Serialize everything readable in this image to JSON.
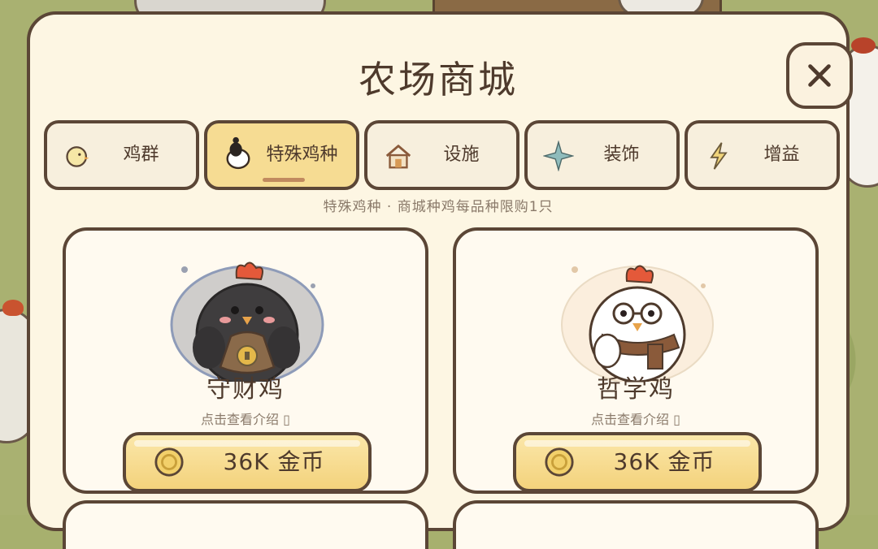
{
  "shop": {
    "title": "农场商城",
    "subtitle": "特殊鸡种 · 商城种鸡每品种限购1只"
  },
  "tabs": [
    {
      "label": "鸡群",
      "icon": "chick-icon",
      "active": false
    },
    {
      "label": "特殊鸡种",
      "icon": "special-chicken-icon",
      "active": true
    },
    {
      "label": "设施",
      "icon": "house-icon",
      "active": false
    },
    {
      "label": "装饰",
      "icon": "sparkle-icon",
      "active": false
    },
    {
      "label": "增益",
      "icon": "lightning-icon",
      "active": false
    }
  ],
  "products": [
    {
      "name": "守财鸡",
      "hint": "点击查看介绍 ▯",
      "price": "36K 金币",
      "icon": "money-bag-chicken-icon"
    },
    {
      "name": "哲学鸡",
      "hint": "点击查看介绍 ▯",
      "price": "36K 金币",
      "icon": "glasses-chicken-icon"
    }
  ],
  "colors": {
    "border": "#5b4636",
    "panel": "#fdf6e3",
    "active_tab": "#f6dc93",
    "button": "#f3d27c",
    "text": "#4e3a2c"
  }
}
